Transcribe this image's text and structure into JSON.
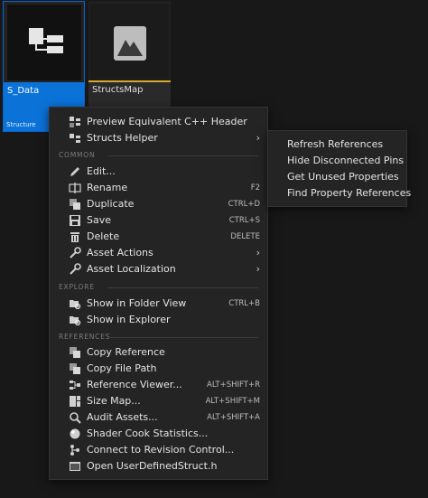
{
  "assets": [
    {
      "name": "S_Data",
      "type": "Structure",
      "icon": "structure-icon"
    },
    {
      "name": "StructsMap",
      "type": "",
      "icon": "data-asset-icon"
    }
  ],
  "menu": {
    "top": [
      {
        "label": "Preview Equivalent C++ Header",
        "icon": "cpp-header-icon"
      },
      {
        "label": "Structs Helper",
        "icon": "structs-helper-icon",
        "arrow": "›"
      }
    ],
    "sections": {
      "common": "COMMON",
      "explore": "EXPLORE",
      "references": "REFERENCES"
    },
    "common": [
      {
        "label": "Edit...",
        "icon": "edit-icon",
        "shortcut": ""
      },
      {
        "label": "Rename",
        "icon": "rename-icon",
        "shortcut": "F2"
      },
      {
        "label": "Duplicate",
        "icon": "duplicate-icon",
        "shortcut": "CTRL+D"
      },
      {
        "label": "Save",
        "icon": "save-icon",
        "shortcut": "CTRL+S"
      },
      {
        "label": "Delete",
        "icon": "delete-icon",
        "shortcut": "DELETE"
      },
      {
        "label": "Asset Actions",
        "icon": "asset-actions-icon",
        "arrow": "›"
      },
      {
        "label": "Asset Localization",
        "icon": "localization-icon",
        "arrow": "›"
      }
    ],
    "explore": [
      {
        "label": "Show in Folder View",
        "icon": "folder-view-icon",
        "shortcut": "CTRL+B"
      },
      {
        "label": "Show in Explorer",
        "icon": "explorer-icon",
        "shortcut": ""
      }
    ],
    "references": [
      {
        "label": "Copy Reference",
        "icon": "copy-reference-icon",
        "shortcut": ""
      },
      {
        "label": "Copy File Path",
        "icon": "copy-path-icon",
        "shortcut": ""
      },
      {
        "label": "Reference Viewer...",
        "icon": "reference-viewer-icon",
        "shortcut": "ALT+SHIFT+R"
      },
      {
        "label": "Size Map...",
        "icon": "size-map-icon",
        "shortcut": "ALT+SHIFT+M"
      },
      {
        "label": "Audit Assets...",
        "icon": "audit-icon",
        "shortcut": "ALT+SHIFT+A"
      },
      {
        "label": "Shader Cook Statistics...",
        "icon": "shader-icon",
        "shortcut": ""
      },
      {
        "label": "Connect to Revision Control...",
        "icon": "revision-control-icon",
        "shortcut": ""
      },
      {
        "label": "Open UserDefinedStruct.h",
        "icon": "open-file-icon",
        "shortcut": ""
      }
    ]
  },
  "submenu": [
    "Refresh References",
    "Hide Disconnected Pins",
    "Get Unused Properties",
    "Find Property References"
  ],
  "colors": {
    "selection": "#0b72d8",
    "accent": "#d7a62b",
    "menu_bg": "#242424"
  }
}
